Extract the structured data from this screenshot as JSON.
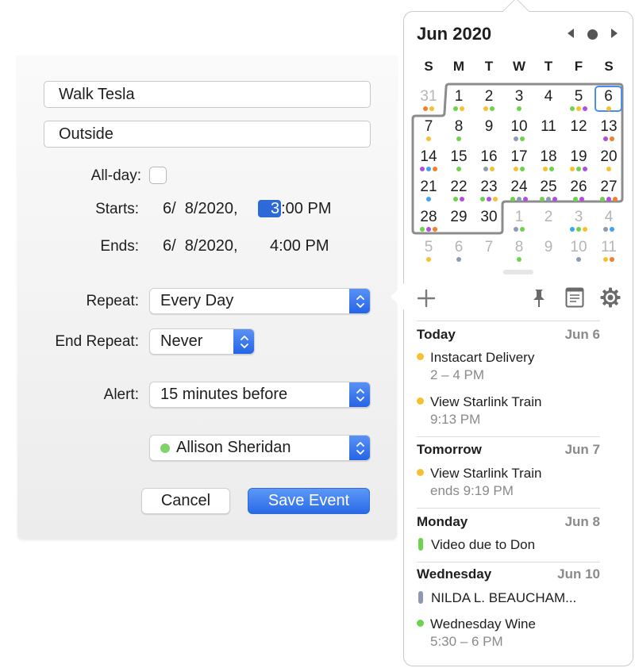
{
  "editor": {
    "title_value": "Walk Tesla",
    "location_value": "Outside",
    "allday_label": "All-day:",
    "allday_checked": false,
    "starts_label": "Starts:",
    "starts_date": "6/  8/2020,",
    "starts_hour": "3",
    "starts_rest": ":00 PM",
    "ends_label": "Ends:",
    "ends_date": "6/  8/2020,",
    "ends_time": "4:00 PM",
    "repeat_label": "Repeat:",
    "repeat_value": "Every Day",
    "end_repeat_label": "End Repeat:",
    "end_repeat_value": "Never",
    "alert_label": "Alert:",
    "alert_value": "15 minutes before",
    "calendar_value": "Allison Sheridan",
    "calendar_color": "#7fd36a",
    "cancel_label": "Cancel",
    "save_label": "Save Event"
  },
  "calendar": {
    "month_title": "Jun 2020",
    "weekdays": [
      "S",
      "M",
      "T",
      "W",
      "T",
      "F",
      "S"
    ],
    "today": "6",
    "colors": {
      "orange": "#f0812a",
      "yellow": "#f5c032",
      "green": "#6fd24f",
      "purple": "#b14fdc",
      "blue": "#3ea3f3",
      "gray": "#8e9ab5"
    },
    "weeks": [
      [
        {
          "d": "31",
          "other": true,
          "dots": [
            "orange",
            "yellow"
          ]
        },
        {
          "d": "1",
          "dots": [
            "green",
            "yellow"
          ]
        },
        {
          "d": "2",
          "dots": [
            "yellow",
            "green"
          ]
        },
        {
          "d": "3",
          "dots": [
            "green"
          ]
        },
        {
          "d": "4",
          "dots": []
        },
        {
          "d": "5",
          "dots": [
            "green",
            "yellow",
            "purple"
          ]
        },
        {
          "d": "6",
          "today": true,
          "dots": [
            "yellow"
          ]
        }
      ],
      [
        {
          "d": "7",
          "dots": [
            "yellow"
          ]
        },
        {
          "d": "8",
          "dots": [
            "green"
          ]
        },
        {
          "d": "9",
          "dots": []
        },
        {
          "d": "10",
          "dots": [
            "gray",
            "green"
          ]
        },
        {
          "d": "11",
          "dots": []
        },
        {
          "d": "12",
          "dots": []
        },
        {
          "d": "13",
          "dots": [
            "purple",
            "orange"
          ]
        }
      ],
      [
        {
          "d": "14",
          "dots": [
            "purple",
            "blue",
            "orange"
          ]
        },
        {
          "d": "15",
          "dots": [
            "green"
          ]
        },
        {
          "d": "16",
          "dots": [
            "gray",
            "yellow"
          ]
        },
        {
          "d": "17",
          "dots": [
            "yellow",
            "green"
          ]
        },
        {
          "d": "18",
          "dots": [
            "yellow",
            "green"
          ]
        },
        {
          "d": "19",
          "dots": [
            "yellow",
            "green",
            "purple"
          ]
        },
        {
          "d": "20",
          "dots": [
            "yellow"
          ]
        }
      ],
      [
        {
          "d": "21",
          "dots": [
            "blue"
          ]
        },
        {
          "d": "22",
          "dots": [
            "green",
            "purple"
          ]
        },
        {
          "d": "23",
          "dots": [
            "green",
            "purple",
            "yellow"
          ]
        },
        {
          "d": "24",
          "dots": [
            "green",
            "gray",
            "purple"
          ]
        },
        {
          "d": "25",
          "dots": [
            "green",
            "gray",
            "purple"
          ]
        },
        {
          "d": "26",
          "dots": [
            "green",
            "purple"
          ]
        },
        {
          "d": "27",
          "dots": [
            "green",
            "purple",
            "orange"
          ]
        }
      ],
      [
        {
          "d": "28",
          "dots": [
            "green",
            "purple",
            "orange"
          ]
        },
        {
          "d": "29",
          "dots": []
        },
        {
          "d": "30",
          "dots": []
        },
        {
          "d": "1",
          "other": true,
          "dots": [
            "gray",
            "green"
          ]
        },
        {
          "d": "2",
          "other": true,
          "dots": []
        },
        {
          "d": "3",
          "other": true,
          "dots": [
            "blue",
            "green",
            "yellow"
          ]
        },
        {
          "d": "4",
          "other": true,
          "dots": [
            "gray",
            "blue"
          ]
        }
      ],
      [
        {
          "d": "5",
          "other": true,
          "dots": [
            "yellow"
          ]
        },
        {
          "d": "6",
          "other": true,
          "dots": [
            "gray"
          ]
        },
        {
          "d": "7",
          "other": true,
          "dots": []
        },
        {
          "d": "8",
          "other": true,
          "dots": [
            "green"
          ]
        },
        {
          "d": "9",
          "other": true,
          "dots": []
        },
        {
          "d": "10",
          "other": true,
          "dots": [
            "gray"
          ]
        },
        {
          "d": "11",
          "other": true,
          "dots": [
            "yellow",
            "orange"
          ]
        }
      ]
    ]
  },
  "toolbar": {
    "add_icon": "plus-icon",
    "pin_icon": "pin-icon",
    "notes_icon": "notes-icon",
    "settings_icon": "gear-icon"
  },
  "agenda": [
    {
      "day": "Today",
      "date": "Jun 6",
      "events": [
        {
          "title": "Instacart Delivery",
          "sub": "2 – 4 PM",
          "color": "#f5c032",
          "shape": "dot"
        },
        {
          "title": "View Starlink Train",
          "sub": "9:13 PM",
          "color": "#f5c032",
          "shape": "dot"
        }
      ]
    },
    {
      "day": "Tomorrow",
      "date": "Jun 7",
      "events": [
        {
          "title": "View Starlink Train",
          "sub": "ends 9:19 PM",
          "color": "#f5c032",
          "shape": "dot"
        }
      ]
    },
    {
      "day": "Monday",
      "date": "Jun 8",
      "events": [
        {
          "title": "Video due to Don",
          "sub": "",
          "color": "#6fd24f",
          "shape": "bar"
        }
      ]
    },
    {
      "day": "Wednesday",
      "date": "Jun 10",
      "events": [
        {
          "title": "NILDA L. BEAUCHAM...",
          "sub": "",
          "color": "#8e9ab5",
          "shape": "bar"
        },
        {
          "title": "Wednesday Wine",
          "sub": "5:30 – 6 PM",
          "color": "#6fd24f",
          "shape": "dot"
        }
      ]
    }
  ]
}
